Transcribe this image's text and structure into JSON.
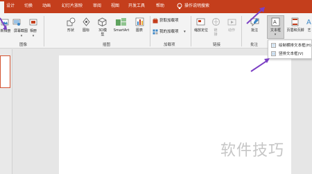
{
  "tabs": [
    {
      "label": "设计"
    },
    {
      "label": "切换"
    },
    {
      "label": "动画"
    },
    {
      "label": "幻灯片放映"
    },
    {
      "label": "审阅"
    },
    {
      "label": "视图"
    },
    {
      "label": "开发工具"
    },
    {
      "label": "帮助"
    }
  ],
  "tell_me": "操作说明搜索",
  "ribbon": {
    "new_photo_album": "新相册",
    "screenshot": "屏幕截图",
    "album": "相册",
    "images_group": "图像",
    "shapes": "形状",
    "icons": "图标",
    "model_3d": "3D模型",
    "smartart": "SmartArt",
    "chart": "图表",
    "illustrations_group": "插图",
    "get_addins": "获取加载项",
    "my_addins": "我的加载项",
    "addins_group": "加载项",
    "zoom": "缩放定位",
    "link": "链接",
    "action": "动作",
    "links_group": "链接",
    "comment": "批注",
    "comments_group": "批注",
    "textbox": "文本框",
    "header_footer": "页眉和页脚",
    "art": "艺"
  },
  "dropdown": {
    "items": [
      {
        "label": "绘制横排文本框(H)"
      },
      {
        "label": "竖排文本框(V)"
      }
    ]
  },
  "watermark": "软件技巧",
  "colors": {
    "accent": "#c43e1c",
    "arrow": "#7b3fc4"
  }
}
